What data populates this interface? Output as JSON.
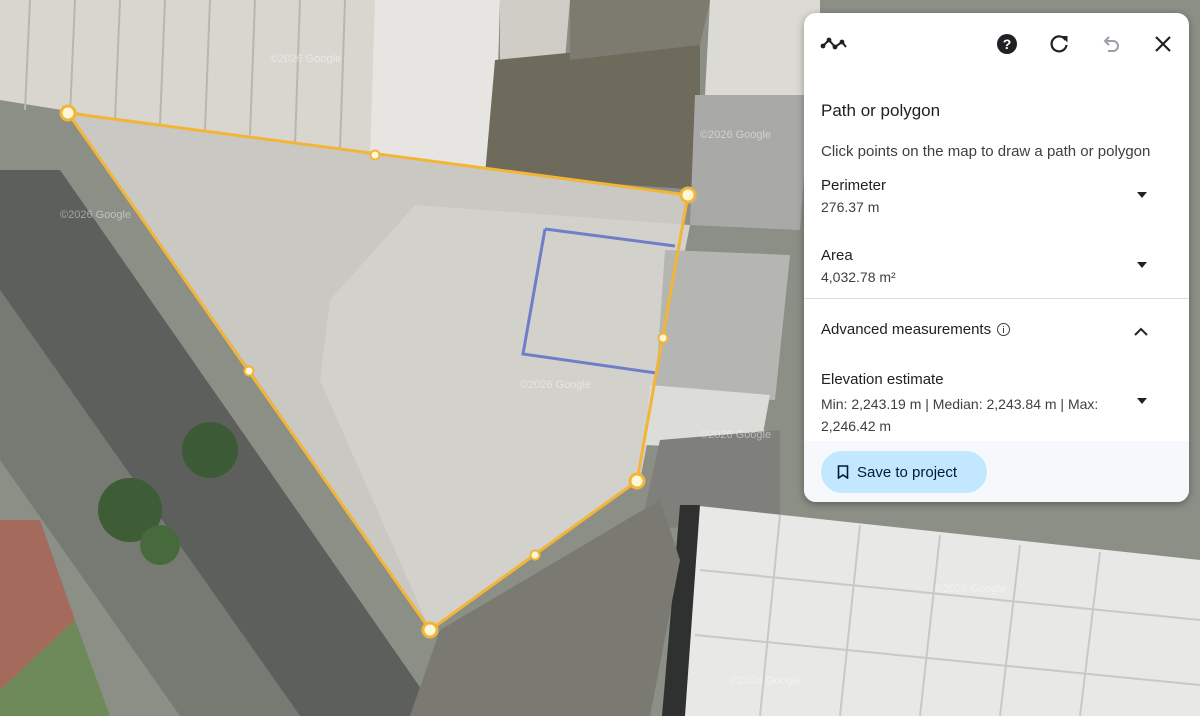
{
  "map": {
    "watermarks": [
      "©2026 Google",
      "©2026 Google",
      "©2026 Google",
      "©2026 Google",
      "©2026 Google",
      "©2026 Google",
      "©2026 Google"
    ],
    "polygon_color": "#f2b538",
    "selection_color": "#6f7ec8"
  },
  "panel": {
    "toolbar_icons": [
      "path-tool-icon",
      "help-icon",
      "refresh-icon",
      "undo-icon",
      "close-icon"
    ],
    "title": "Path or polygon",
    "subtitle": "Click points on the map to draw a path or polygon",
    "perimeter": {
      "label": "Perimeter",
      "value": "276.37 m"
    },
    "area": {
      "label": "Area",
      "value": "4,032.78 m²"
    },
    "advanced": {
      "label": "Advanced measurements"
    },
    "elevation": {
      "label": "Elevation estimate",
      "value": "Min: 2,243.19 m | Median: 2,243.84 m | Max: 2,246.42 m"
    },
    "save_button": {
      "label": "Save to project"
    },
    "accent": "#c2e7ff"
  }
}
